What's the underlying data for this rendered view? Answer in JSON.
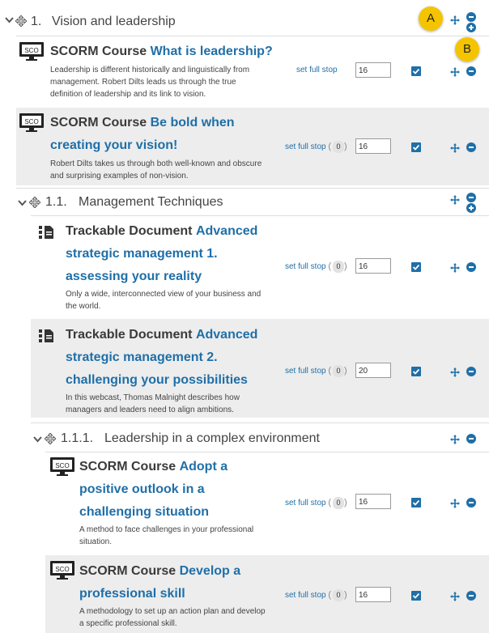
{
  "callouts": {
    "a": "A",
    "b": "B"
  },
  "sections": [
    {
      "number": "1.",
      "title": "Vision and leadership"
    },
    {
      "number": "1.1.",
      "title": "Management Techniques"
    },
    {
      "number": "1.1.1.",
      "title": "Leadership in a complex environment"
    }
  ],
  "set_full_stop_label": "set full stop",
  "zero_badge": "0",
  "items": [
    {
      "type": "SCORM Course",
      "title_lines": [
        "What is leadership?"
      ],
      "description_lines": [
        "Leadership is different historically and linguistically from",
        "management. Robert Dilts leads us through the true",
        "definition of leadership and its link to vision."
      ],
      "value": "16",
      "icon": "sco-monitor-icon"
    },
    {
      "type": "SCORM Course",
      "title_lines": [
        "Be bold when",
        "creating your vision!"
      ],
      "description_lines": [
        "Robert Dilts takes us through both well-known and obscure",
        "and surprising examples of non-vision."
      ],
      "value": "16",
      "icon": "sco-monitor-icon"
    },
    {
      "type": "Trackable Document",
      "title_lines": [
        "Advanced",
        "strategic management 1.",
        "assessing your reality"
      ],
      "description_lines": [
        "Only a wide, interconnected view of your business and",
        "the world."
      ],
      "value": "16",
      "icon": "trackable-document-icon"
    },
    {
      "type": "Trackable Document",
      "title_lines": [
        "Advanced",
        "strategic management 2.",
        "challenging your possibilities"
      ],
      "description_lines": [
        "In this webcast, Thomas Malnight describes how",
        "managers and leaders need to align ambitions."
      ],
      "value": "20",
      "icon": "trackable-document-icon"
    },
    {
      "type": "SCORM Course",
      "title_lines": [
        "Adopt a",
        "positive outlook in a",
        "challenging situation"
      ],
      "description_lines": [
        "A method to face challenges in your professional",
        "situation."
      ],
      "value": "16",
      "icon": "sco-monitor-icon"
    },
    {
      "type": "SCORM Course",
      "title_lines": [
        "Develop a",
        "professional skill"
      ],
      "description_lines": [
        "A methodology to set up an action plan and develop",
        "a specific professional skill."
      ],
      "value": "16",
      "icon": "sco-monitor-icon"
    }
  ],
  "colors": {
    "accent": "#1f6fa8",
    "callout": "#f5c400",
    "item_grey": "#ededed"
  },
  "icons": {
    "collapse": "chevron-down-icon",
    "move": "move-arrows-icon",
    "add": "plus-icon",
    "remove": "minus-circle-icon",
    "add_circle": "plus-circle-icon",
    "done": "checkbox-checked-icon"
  }
}
